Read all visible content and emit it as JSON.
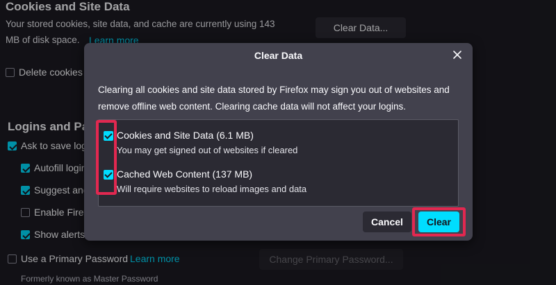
{
  "background": {
    "cookies_section": {
      "title": "Cookies and Site Data",
      "desc_line1": "Your stored cookies, site data, and cache are currently using 143",
      "desc_line2": "MB of disk space.",
      "learn_more": "Learn more",
      "clear_data_button": "Clear Data...",
      "delete_cookies_label": "Delete cookies"
    },
    "logins_section": {
      "title": "Logins and Pas",
      "ask_to_save": "Ask to save log",
      "autofill": "Autofill login",
      "suggest": "Suggest and",
      "enable": "Enable Firef",
      "show_alerts": "Show alerts",
      "primary_password_label": "Use a Primary Password",
      "primary_learn_more": "Learn more",
      "change_primary_button": "Change Primary Password...",
      "formerly_known": "Formerly known as Master Password"
    }
  },
  "dialog": {
    "title": "Clear Data",
    "description": "Clearing all cookies and site data stored by Firefox may sign you out of websites and remove offline web content. Clearing cache data will not affect your logins.",
    "items": [
      {
        "label": "Cookies and Site Data (6.1 MB)",
        "sublabel": "You may get signed out of websites if cleared",
        "checked": true
      },
      {
        "label": "Cached Web Content (137 MB)",
        "sublabel": "Will require websites to reload images and data",
        "checked": true
      }
    ],
    "cancel_label": "Cancel",
    "clear_label": "Clear"
  },
  "colors": {
    "accent": "#00ddff",
    "highlight": "#e22850",
    "dialog_bg": "#42414d",
    "page_bg": "#1c1b22"
  }
}
